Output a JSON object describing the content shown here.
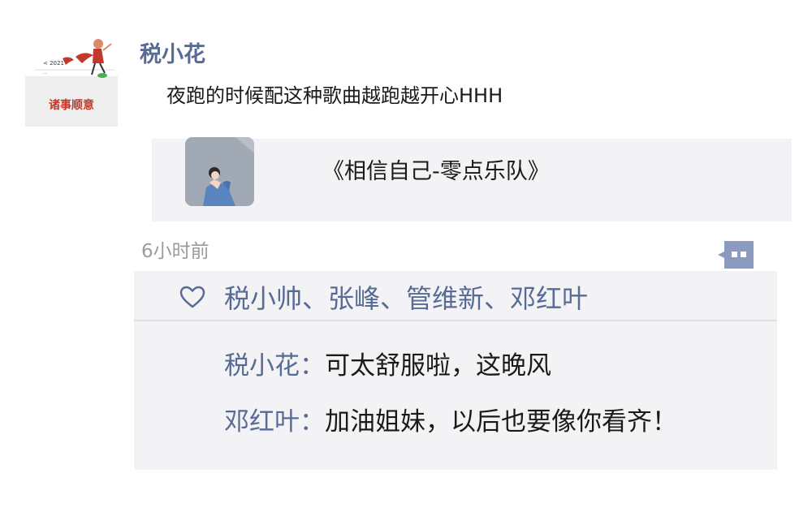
{
  "post": {
    "author": "税小花",
    "text": "夜跑的时候配这种歌曲越跑越开心HHH",
    "music_title": "《相信自己-零点乐队》",
    "time": "6小时前"
  },
  "avatar": {
    "caption": "诸事顺意",
    "year": "< 2021"
  },
  "likes": {
    "names": "税小帅、张峰、管维新、邓红叶"
  },
  "comments": [
    {
      "name": "税小花",
      "separator": "：",
      "text": "可太舒服啦，这晚风"
    },
    {
      "name": "邓红叶",
      "separator": "：",
      "text": "加油姐妹，以后也要像你看齐！"
    }
  ],
  "colors": {
    "name_blue": "#576b95",
    "panel_gray": "#f3f3f5",
    "time_gray": "#9b9b9b"
  },
  "icons": {
    "like": "heart-outline-icon",
    "comment": "comment-dots-icon"
  }
}
